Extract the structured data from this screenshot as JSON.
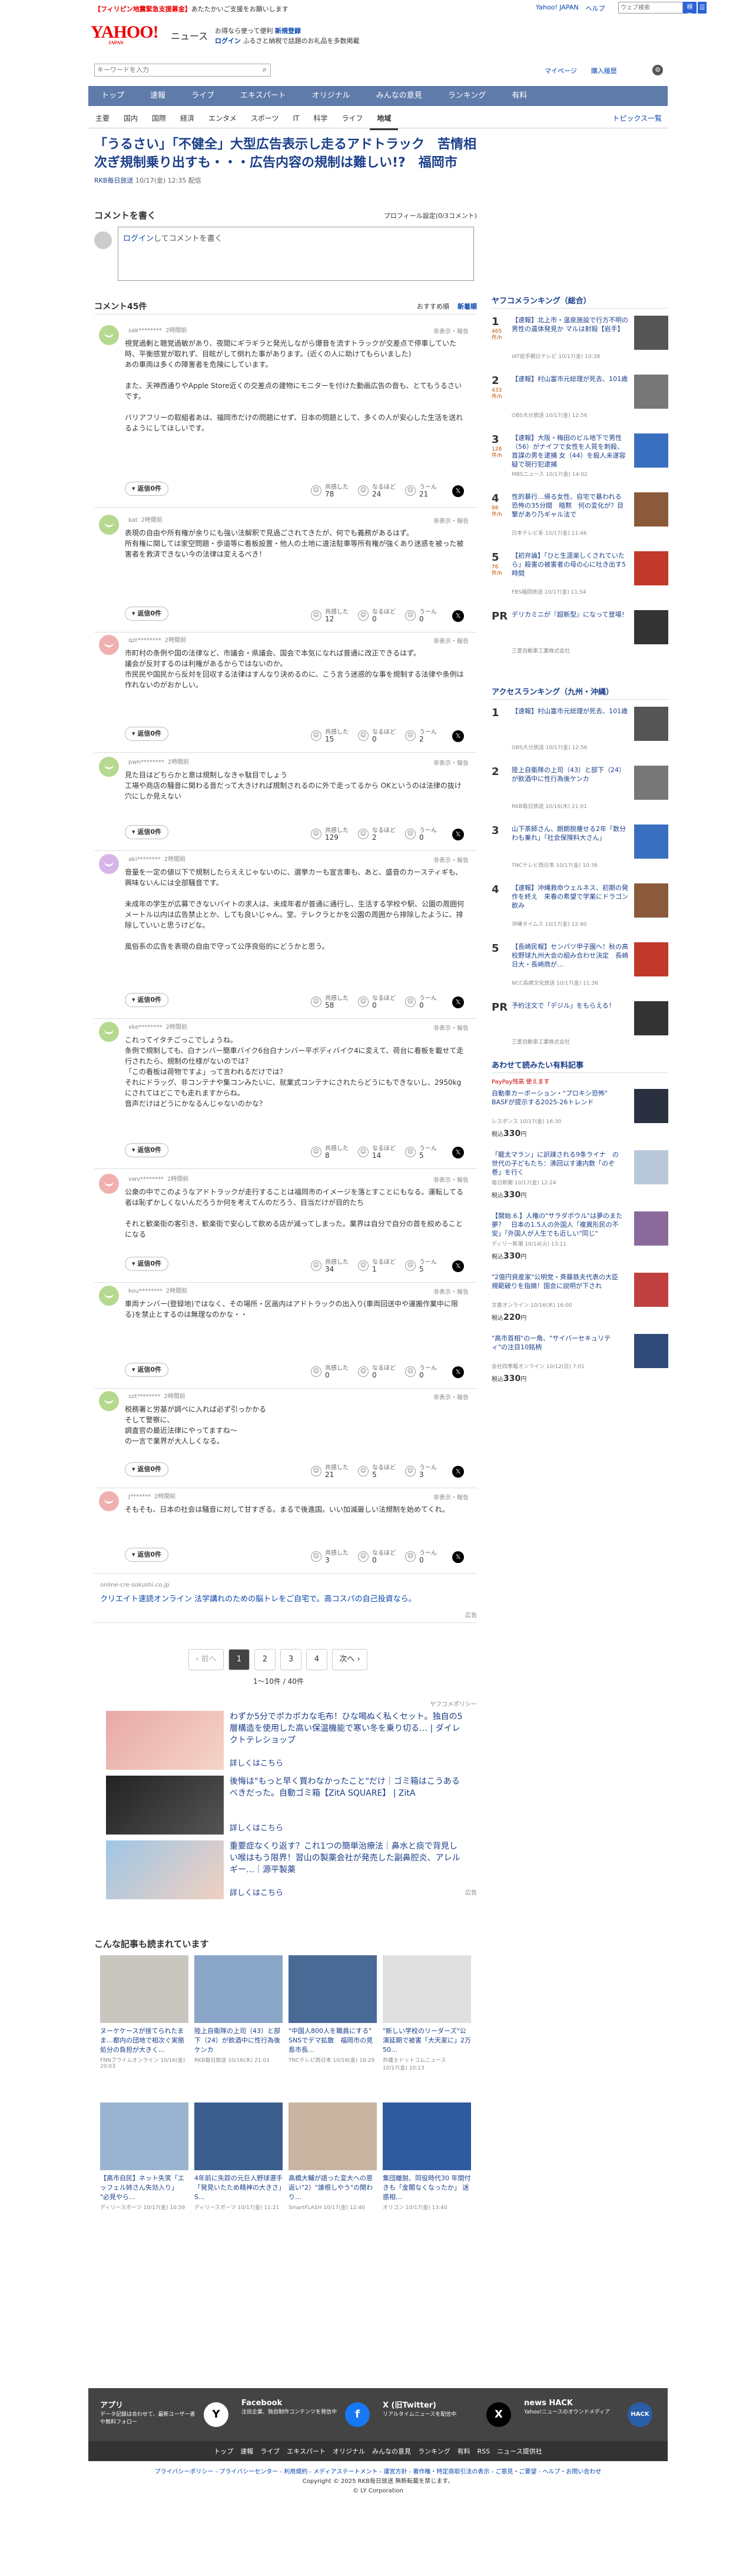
{
  "top": {
    "pr_text": "【フィリピン地震緊急支援募金】",
    "pr_rest": "あたたかいご支援をお願いします",
    "links": [
      "Yahoo! JAPAN",
      "ヘルプ"
    ],
    "search_placeholder": "ウェブ検索",
    "search_btn": "検索"
  },
  "masthead": {
    "logo": "YAHOO!",
    "logo_sub": "JAPAN",
    "section": "ニュース",
    "promo1_a": "お得なら使って便利",
    "promo1_b": "新規登録",
    "promo2_a": "ログイン",
    "promo2_b": "ふるさと納税で話題のお礼品を多数掲載"
  },
  "searchrow": {
    "placeholder": "キーワードを入力",
    "right": [
      "マイページ",
      "購入履歴"
    ]
  },
  "nav_main": [
    "トップ",
    "速報",
    "ライブ",
    "エキスパート",
    "オリジナル",
    "みんなの意見",
    "ランキング",
    "有料"
  ],
  "nav_sub": [
    "主要",
    "国内",
    "国際",
    "経済",
    "エンタメ",
    "スポーツ",
    "IT",
    "科学",
    "ライフ",
    "地域"
  ],
  "nav_sub_right": "トピックス一覧",
  "article": {
    "title": "「うるさい」「不健全」大型広告表示し走るアドトラック　苦情相次ぎ規制乗り出すも・・・広告内容の規制は難しい!?　福岡市",
    "source": "RKB毎日放送",
    "date": "10/17(金) 12:35 配信"
  },
  "comment_head": {
    "title": "コメントを書く",
    "profile": "プロフィール設定(0/3コメント)"
  },
  "comment_box": {
    "login": "ログイン",
    "rest": "してコメントを書く"
  },
  "clist": {
    "title": "コメント45件",
    "sort": [
      "おすすめ順",
      "新着順"
    ]
  },
  "report": "非表示・報告",
  "reply_btn": "返信0件",
  "vote_labels": [
    "共感した",
    "なるほど",
    "うーん"
  ],
  "comments": [
    {
      "user": "sak********",
      "time": "2時間前",
      "body": "視覚過剰と聴覚過敏があり、夜間にギラギラと発光しながら爆音を流すトラックが交差点で停車していた時、平衡感覚が取れず、目眩がして倒れた事があります。(近くの人に助けてもらいました)\nあの車両は多くの障害者を危険にしています。\n\nまた、天神西通りやApple Store近くの交差点の建物にモニターを付けた動画広告の音も、とてもうるさいです。\n\nバリアフリーの取組者あは、福岡市だけの問題にせず、日本の問題として、多くの人が安心した生活を送れるようにしてほしいです。",
      "v": [
        78,
        24,
        21
      ]
    },
    {
      "user": "kat",
      "time": "2時間前",
      "body": "表現の自由や所有権が余りにも強い法解釈で見過ごされてきたが、何でも義務があるはず。\n所有権に関しては家空問題・歩道等に看板設置・他人の土地に違法駐車等所有権が強くあり迷惑を被った被害者を救済できない今の法律は変えるべき！",
      "v": [
        12,
        0,
        0
      ]
    },
    {
      "user": "qzr********",
      "time": "2時間前",
      "body": "市町村の条例や国の法律など、市議会・県議会、国会で本気になれば普通に改正できるはず。\n議会が反対するのは利権があるからではないのか。\n市民民や国民から反対を回収する法律はすんなり決めるのに、こう言う迷惑的な事を規制する法律や条例は作れないのがおかしい。",
      "v": [
        15,
        0,
        2
      ]
    },
    {
      "user": "pwn********",
      "time": "2時間前",
      "body": "見た目はどちらかと意は規制しなきゃ駄目でしょう\n工場や商店の騒音に関わる音だって大きければ規制されるのに外で走ってるから OKというのは法律の抜け穴にしか見えない",
      "v": [
        129,
        2,
        0
      ]
    },
    {
      "user": "aki********",
      "time": "2時間前",
      "body": "音量を一定の値以下で規制したらええじゃないのに、選挙カーも宣言車も、あと、盛音のカースティギも、興味ないんには全部騒音です。\n\n未成年の学生が広募できないバイトの求人は、未成年者が普通に通行し、生活する学校や駅、公園の周囲何メートル以内は広告禁止とか、しても良いじゃん。堂、テレクラとかを公園の周囲から排除したように、排除していいと思うけどな。\n\n風俗系の広告を表現の自由で守って公序良俗的にどうかと思う。",
      "v": [
        58,
        0,
        0
      ]
    },
    {
      "user": "xke********",
      "time": "2時間前",
      "body": "これってイタチごっこでしょうね。\n条例で規制しても、白ナンバー簡車バイク6台白ナンバー平ボディバイク4に変えて、荷台に看板を載せて走行されたら、規制の仕様がないのでは？\n「この看板は荷物ですよ」って言われるだけでは？\nそれにドラッグ、非コンテナや集コンみたいに、就業式コンテナにされたらどうにもできないし、2950kgにされてはどこでも走れますからね。\n音声だけはどうにかなるんじゃないのかな？",
      "v": [
        8,
        14,
        5
      ]
    },
    {
      "user": "vwv********",
      "time": "2時間前",
      "body": "公衆の中でこのようなアドトラックが走行することは福岡市のイメージを落とすことにもなる。運転してる者は恥ずかしくないんだろうか何を考えてんのだろう、目当だけが目的たち\n\nそれと歓楽街の客引き、歓楽街で安心して飲める店が減ってしまった。業界は自分で自分の首を絞めることになる",
      "v": [
        34,
        1,
        5
      ]
    },
    {
      "user": "kou********",
      "time": "2時間前",
      "body": "車両ナンバー(登録地)ではなく、その場所・区画内はアドトラックの出入り(車両回送中や運搬作業中に限る)を禁止とするのは無理なのかな・・",
      "v": [
        0,
        0,
        0
      ]
    },
    {
      "user": "szt********",
      "time": "2時間前",
      "body": "税務署と労基が調べに入れば必ず引っかかる\nそして警察に、\n調査官の最近法律にやってますね～\nの一言で業界が大人しくなる。",
      "v": [
        21,
        5,
        3
      ]
    },
    {
      "user": "J*******",
      "time": "2時間前",
      "body": "そもそも、日本の社会は騒音に対して甘すぎる。まるで後進国。いい加減厳しい法規制を始めてくれ。",
      "v": [
        3,
        0,
        0
      ]
    }
  ],
  "ad_comment": {
    "src": "online-cre-sokushi.co.jp",
    "text": "クリエイト速読オンライン 法学講れのための脳トレをご自宅で。高コスパの自己投資なら。",
    "label": "広告"
  },
  "pager": {
    "prev": "前へ",
    "pages": [
      "1",
      "2",
      "3",
      "4"
    ],
    "next": "次へ",
    "info": "1～10件 / 40件"
  },
  "ads": {
    "label": "ヤフコメポリシー",
    "badge": "広告",
    "items": [
      {
        "text": "わずか5分でポカポカな毛布！ひな喝ぬく私くセット。独自の5層構造を使用した高い保温機能で寒い冬を乗り切る… | ダイレクトテレショップ",
        "more": "詳しくはこちら"
      },
      {
        "text": "後悔は\"もっと早く買わなかったこと\"だけ｜ゴミ箱はこうあるべきだった。自動ゴミ箱【ZitA SQUARE】 | ZitA",
        "more": "詳しくはこちら"
      },
      {
        "text": "重要症なくり返す？これ1つの簡単治療法｜鼻水と痰で背見しい喉はもう限界！習山の製薬会社が発売した副鼻腔炎、アレルギー…｜源平製薬",
        "more": "詳しくはこちら"
      }
    ]
  },
  "also": {
    "title": "こんな記事も読まれています",
    "tiles": [
      {
        "title": "ヌーケケースが捨てられたまま…都内の団地で相次ぐ実態　処分の負担が大きく…",
        "src": "FNNプライムオンライン 10/16(金) 20:03"
      },
      {
        "title": "陸上自衛隊の上司（43）と部下（24）が飲酒中に性行為後ケンカ",
        "src": "RKB毎日放送 10/16(木) 21:01"
      },
      {
        "title": "\"中国人800人を職員にする\" SNSでデマ拡散　福岡市の見島市長…",
        "src": "TNCテレビ西日本 10/16(金) 18:29"
      },
      {
        "title": "\"新しい学校のリーダーズ\"公演延期で被害「大天家に」2万50…",
        "src": "弁護士ドットコムニュース 10/17(金) 10:13"
      },
      {
        "title": "【高市自民】ネット失笑「エッフェル姉さん失効入り」 \"必見やら…",
        "src": "ディリースポーツ 10/17(金) 10:59"
      },
      {
        "title": "4年前に失踪の元巨人野球選手「発見いたため精神の大きさ」S…",
        "src": "ディリースポーツ 10/17(金) 11:21"
      },
      {
        "title": "高橋大輔が語った変大への恩返い\"2）\"誰根しやう\"の関わり…",
        "src": "SmartFLASH 10/17(金) 12:40"
      },
      {
        "title": "集団離脱、同役時代30 年間付きも「金閣なくなったか」 迷惑相…",
        "src": "オリコン 10/17(金) 13:40"
      }
    ]
  },
  "sidebar": {
    "rank_title": "ヤフコメランキング（総合）",
    "rank": [
      {
        "n": "1",
        "c": "465 件/h",
        "t": "【速報】北上市・温泉施設で行方不明の男性の遺体発見か マルは射殺【岩手】",
        "s": "IAT岩手朝日テレビ 10/17(金) 10:38"
      },
      {
        "n": "2",
        "c": "433 件/h",
        "t": "【速報】村山富市元総理が死去、101歳",
        "s": "OBS大分放送 10/17(金) 12:56"
      },
      {
        "n": "3",
        "c": "128 件/h",
        "t": "【速報】大阪・梅田のビル地下で男性（56）がナイフで女性を人質を刺殺、首謀の男を逮捕 女（44）を殺人未遂容疑で現行犯逮捕",
        "s": "MBSニュース 10/17(金) 14:02"
      },
      {
        "n": "4",
        "c": "98 件/h",
        "t": "性的暴行…帰る女性、自宅で暴われる　恐怖の35分間　暗黙　何の変化が？目撃があり乃ギャル法で",
        "s": "日本テレビ系 10/17(金) 11:46"
      },
      {
        "n": "5",
        "c": "76 件/h",
        "t": "【初弁論】「ひと生涯楽しくされていたら」殺害の被害者の母の心に吐き出す5時間",
        "s": "FBS福岡放送 10/17(金) 11:54"
      },
      {
        "n": "PR",
        "c": "",
        "t": "デリカミニが『超新型』になって登場！",
        "s": "三菱自動車工業株式会社"
      }
    ],
    "access_title": "アクセスランキング（九州・沖縄）",
    "access": [
      {
        "n": "1",
        "t": "【速報】村山富市元総理が死去、101歳",
        "s": "OBS大分放送 10/17(金) 12:56"
      },
      {
        "n": "2",
        "t": "陸上自衛隊の上司（43）と部下（24）が飲酒中に性行為後ケンカ",
        "s": "RKB毎日放送 10/16(木) 21:01"
      },
      {
        "n": "3",
        "t": "山下茶師さん、朗朗脱痩せる2年「数分わも乗れ」「社会保険料大さん」",
        "s": "TNCテレビ西日本 10/17(金) 10:36"
      },
      {
        "n": "4",
        "t": "【速報】沖縄救命ウェルネス、初期の発作を終え　来春の希望で学業にドラゴン飲み",
        "s": "沖縄タイムス 10/17(金) 12:40"
      },
      {
        "n": "5",
        "t": "【長崎民報】センバツ甲子園へ！秋の高校野球九州大会の組み合わせ決定　長崎日大・長崎商が…",
        "s": "NCC長崎文化放送 10/17(金) 11:36"
      },
      {
        "n": "PR",
        "t": "予約注文で「デジル」をもらえる！",
        "s": "三菱自動車工業株式会社"
      }
    ],
    "paid_title": "あわせて読みたい有料記事",
    "paid_label": "PayPay残高 使えます",
    "paid": [
      {
        "t": "自動車カーボーション・\"プロキシ恐怖\"　BASFが提示する2025-26トレンド",
        "s": "レスポンス 10/17(金) 16:30",
        "p": "330"
      },
      {
        "t": "「龍太マラン」に訳疎される9条ライナ　の世代の子どもたち：沸回以す連内数「のぞ巻」を行く",
        "s": "毎日新聞 10/17(金) 12:24",
        "p": "330"
      },
      {
        "t": "【開始.6.】人権の\"サラダボウル\"は夢のまた夢？　日本の1.5人の外国人「複異形民の不安」「外国人が人生でも近しい\"同じ\"",
        "s": "ディリー新潮 10/14(火) 13:11",
        "p": "330"
      },
      {
        "t": "\"2億円資産家\"公明党・斉藤鉄夫代表の大臣規範破りを指摘！国会に説明が下され",
        "s": "文春オンライン 10/16(木) 16:00",
        "p": "220"
      },
      {
        "t": "\"高市首相\"の一角、\"サイバーセキュリティ\"の注目10銘柄",
        "s": "会社四季報オンライン 10/12(日) 7:01",
        "p": "330"
      }
    ]
  },
  "footer": {
    "items": [
      {
        "t": "アプリ",
        "d": "データ記録は合わせて、最新ユーザー者や無料フォロー",
        "lg": "Y"
      },
      {
        "t": "Facebook",
        "d": "注目企業、独自制作コンテンツを発信中",
        "lg": "f"
      },
      {
        "t": "X (旧Twitter)",
        "d": "リアルタイムニュースを配信中",
        "lg": "X"
      },
      {
        "t": "news HACK",
        "d": "Yahoo!ニュースのオウンドメディア",
        "lg": "HACK"
      }
    ],
    "nav": [
      "トップ",
      "速報",
      "ライブ",
      "エキスパート",
      "オリジナル",
      "みんなの意見",
      "ランキング",
      "有料",
      "RSS",
      "ニュース提供社"
    ],
    "links": "プライバシーポリシー - プライバシーセンター - 利用規約 - メディアステートメント - 運営方針 - 著作権・特定商取引法の表示 - ご意見・ご要望 - ヘルプ・お問い合わせ",
    "copy1": "Copyright © 2025 RKB毎日放送 無断転載を禁じます。",
    "copy2": "© LY Corporation"
  },
  "colors": {
    "brand": "#ff0033",
    "nav": "#5f7baa",
    "link": "#1b3f8a"
  }
}
